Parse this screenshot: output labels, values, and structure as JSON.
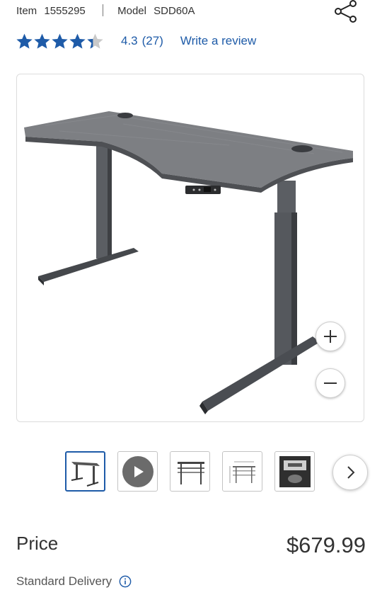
{
  "product": {
    "item_label": "Item",
    "item_number": "1555295",
    "model_label": "Model",
    "model_number": "SDD60A"
  },
  "rating": {
    "value": "4.3",
    "count": "(27)",
    "stars": 4.3,
    "write_review": "Write a review"
  },
  "gallery": {
    "thumbnails": [
      {
        "name": "desk-side-view",
        "selected": true
      },
      {
        "name": "video",
        "selected": false
      },
      {
        "name": "desk-front-view",
        "selected": false
      },
      {
        "name": "desk-dimensions",
        "selected": false
      },
      {
        "name": "controller-closeup",
        "selected": false
      }
    ]
  },
  "pricing": {
    "label": "Price",
    "value": "$679.99"
  },
  "delivery": {
    "label": "Standard Delivery"
  },
  "icons": {
    "share": "share-icon",
    "zoom_in": "plus-icon",
    "zoom_out": "minus-icon",
    "next": "chevron-right-icon",
    "info": "info-icon"
  },
  "colors": {
    "accent": "#1e5ba8",
    "star": "#1e5ba8",
    "text": "#333333"
  }
}
